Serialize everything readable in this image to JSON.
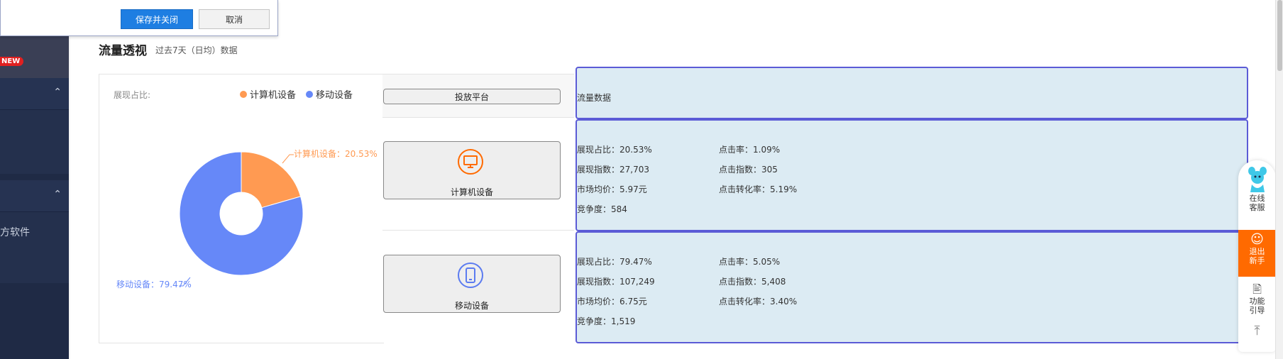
{
  "dialog": {
    "save_label": "保存并关闭",
    "cancel_label": "取消"
  },
  "sidebar": {
    "badge": "NEW",
    "item_label": "方软件"
  },
  "header": {
    "title": "流量透视",
    "subtitle": "过去7天（日均）数据"
  },
  "colors": {
    "computer": "#ff9a52",
    "mobile": "#6688f8",
    "accent": "#1e7ee2",
    "panel_border": "#5b5bd6",
    "panel_bg": "#dcebf3"
  },
  "pie": {
    "label": "展现占比:",
    "legend": [
      {
        "name": "计算机设备"
      },
      {
        "name": "移动设备"
      }
    ],
    "callout_computer": "计算机设备：20.53%",
    "callout_mobile": "移动设备：79.47%"
  },
  "chart_data": {
    "type": "pie",
    "title": "",
    "categories": [
      "计算机设备",
      "移动设备"
    ],
    "values": [
      20.53,
      79.47
    ],
    "unit": "%",
    "donut": true,
    "legend_position": "top-right"
  },
  "table": {
    "platform_header": "投放平台",
    "data_header": "流量数据",
    "rows": [
      {
        "device": "计算机设备",
        "icon": "monitor-icon",
        "stats_left": [
          "展现占比：20.53%",
          "展现指数：27,703",
          "市场均价：5.97元",
          "竞争度：584"
        ],
        "stats_right": [
          "点击率：1.09%",
          "点击指数：305",
          "点击转化率：5.19%"
        ]
      },
      {
        "device": "移动设备",
        "icon": "phone-icon",
        "stats_left": [
          "展现占比：79.47%",
          "展现指数：107,249",
          "市场均价：6.75元",
          "竞争度：1,519"
        ],
        "stats_right": [
          "点击率：5.05%",
          "点击指数：5,408",
          "点击转化率：3.40%"
        ]
      }
    ]
  },
  "right_float": {
    "service_label": "在线\n客服",
    "exit_label": "退出\n新手",
    "guide_label": "功能\n引导"
  }
}
